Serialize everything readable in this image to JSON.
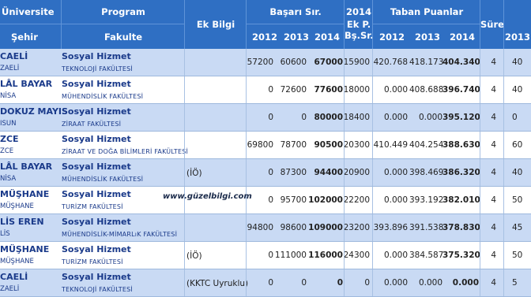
{
  "header": {
    "universite": "Üniversite",
    "sehir": "Şehir",
    "program": "Program",
    "fakulte": "Fakulte",
    "ek_bilgi": "Ek Bilgi",
    "basari": "Başarı Sır.",
    "y2014_top": "2014",
    "ekp_1": "Ek P.",
    "ekp_2": "Bş.Sr.",
    "taban": "Taban Puanlar",
    "sure": "Süre",
    "y2012": "2012",
    "y2013": "2013",
    "y2014": "2014",
    "y2012b": "2012",
    "y2013b": "2013",
    "y2014b": "2014",
    "y2013c": "2013"
  },
  "watermark": "www.güzelbilgi.com",
  "rows": [
    {
      "city": "CAELİ",
      "cityb": "ZAELİ",
      "program": "Sosyal Hizmet",
      "fakulte": "TEKNOLOJİ FAKÜLTESİ",
      "ek": "",
      "b2012": "57200",
      "b2013": "60600",
      "b2014": "67000",
      "ekp": "15900",
      "t2012": "420.768",
      "t2013": "418.173",
      "t2014": "404.340",
      "sure": "4",
      "last": "40"
    },
    {
      "city": "LÂL BAYAR",
      "cityb": "NİSA",
      "program": "Sosyal Hizmet",
      "fakulte": "MÜHENDİSLİK FAKÜLTESİ",
      "ek": "",
      "b2012": "0",
      "b2013": "72600",
      "b2014": "77600",
      "ekp": "18000",
      "t2012": "0.000",
      "t2013": "408.688",
      "t2014": "396.740",
      "sure": "4",
      "last": "40"
    },
    {
      "city": "DOKUZ MAYIS",
      "cityb": "ISUN",
      "program": "Sosyal Hizmet",
      "fakulte": "ZİRAAT FAKÜLTESİ",
      "ek": "",
      "b2012": "0",
      "b2013": "0",
      "b2014": "80000",
      "ekp": "18400",
      "t2012": "0.000",
      "t2013": "0.000",
      "t2014": "395.120",
      "sure": "4",
      "last": "0"
    },
    {
      "city": "ZCE",
      "cityb": "ZCE",
      "program": "Sosyal Hizmet",
      "fakulte": "ZİRAAT VE DOĞA BİLİMLERİ FAKÜLTESİ",
      "ek": "",
      "b2012": "69800",
      "b2013": "78700",
      "b2014": "90500",
      "ekp": "20300",
      "t2012": "410.449",
      "t2013": "404.254",
      "t2014": "388.630",
      "sure": "4",
      "last": "60"
    },
    {
      "city": "LÂL BAYAR",
      "cityb": "NİSA",
      "program": "Sosyal Hizmet",
      "fakulte": "MÜHENDİSLİK FAKÜLTESİ",
      "ek": "(İÖ)",
      "b2012": "0",
      "b2013": "87300",
      "b2014": "94400",
      "ekp": "20900",
      "t2012": "0.000",
      "t2013": "398.469",
      "t2014": "386.320",
      "sure": "4",
      "last": "40"
    },
    {
      "city": "MÜŞHANE",
      "cityb": "MÜŞHANE",
      "program": "Sosyal Hizmet",
      "fakulte": "TURİZM FAKÜLTESİ",
      "ek": "",
      "b2012": "0",
      "b2013": "95700",
      "b2014": "102000",
      "ekp": "22200",
      "t2012": "0.000",
      "t2013": "393.192",
      "t2014": "382.010",
      "sure": "4",
      "last": "50"
    },
    {
      "city": "LİS EREN",
      "cityb": "LİS",
      "program": "Sosyal Hizmet",
      "fakulte": "MÜHENDİSLİK-MİMARLıK FAKÜLTESİ",
      "ek": "",
      "b2012": "94800",
      "b2013": "98600",
      "b2014": "109000",
      "ekp": "23200",
      "t2012": "393.896",
      "t2013": "391.538",
      "t2014": "378.830",
      "sure": "4",
      "last": "45"
    },
    {
      "city": "MÜŞHANE",
      "cityb": "MÜŞHANE",
      "program": "Sosyal Hizmet",
      "fakulte": "TURİZM FAKÜLTESİ",
      "ek": "(İÖ)",
      "b2012": "0",
      "b2013": "111000",
      "b2014": "116000",
      "ekp": "24300",
      "t2012": "0.000",
      "t2013": "384.587",
      "t2014": "375.320",
      "sure": "4",
      "last": "50"
    },
    {
      "city": "CAELİ",
      "cityb": "ZAELİ",
      "program": "Sosyal Hizmet",
      "fakulte": "TEKNOLOJİ FAKÜLTESİ",
      "ek": "(KKTC Uyruklu)",
      "b2012": "0",
      "b2013": "0",
      "b2014": "0",
      "ekp": "0",
      "t2012": "0.000",
      "t2013": "0.000",
      "t2014": "0.000",
      "sure": "4",
      "last": "5"
    }
  ]
}
